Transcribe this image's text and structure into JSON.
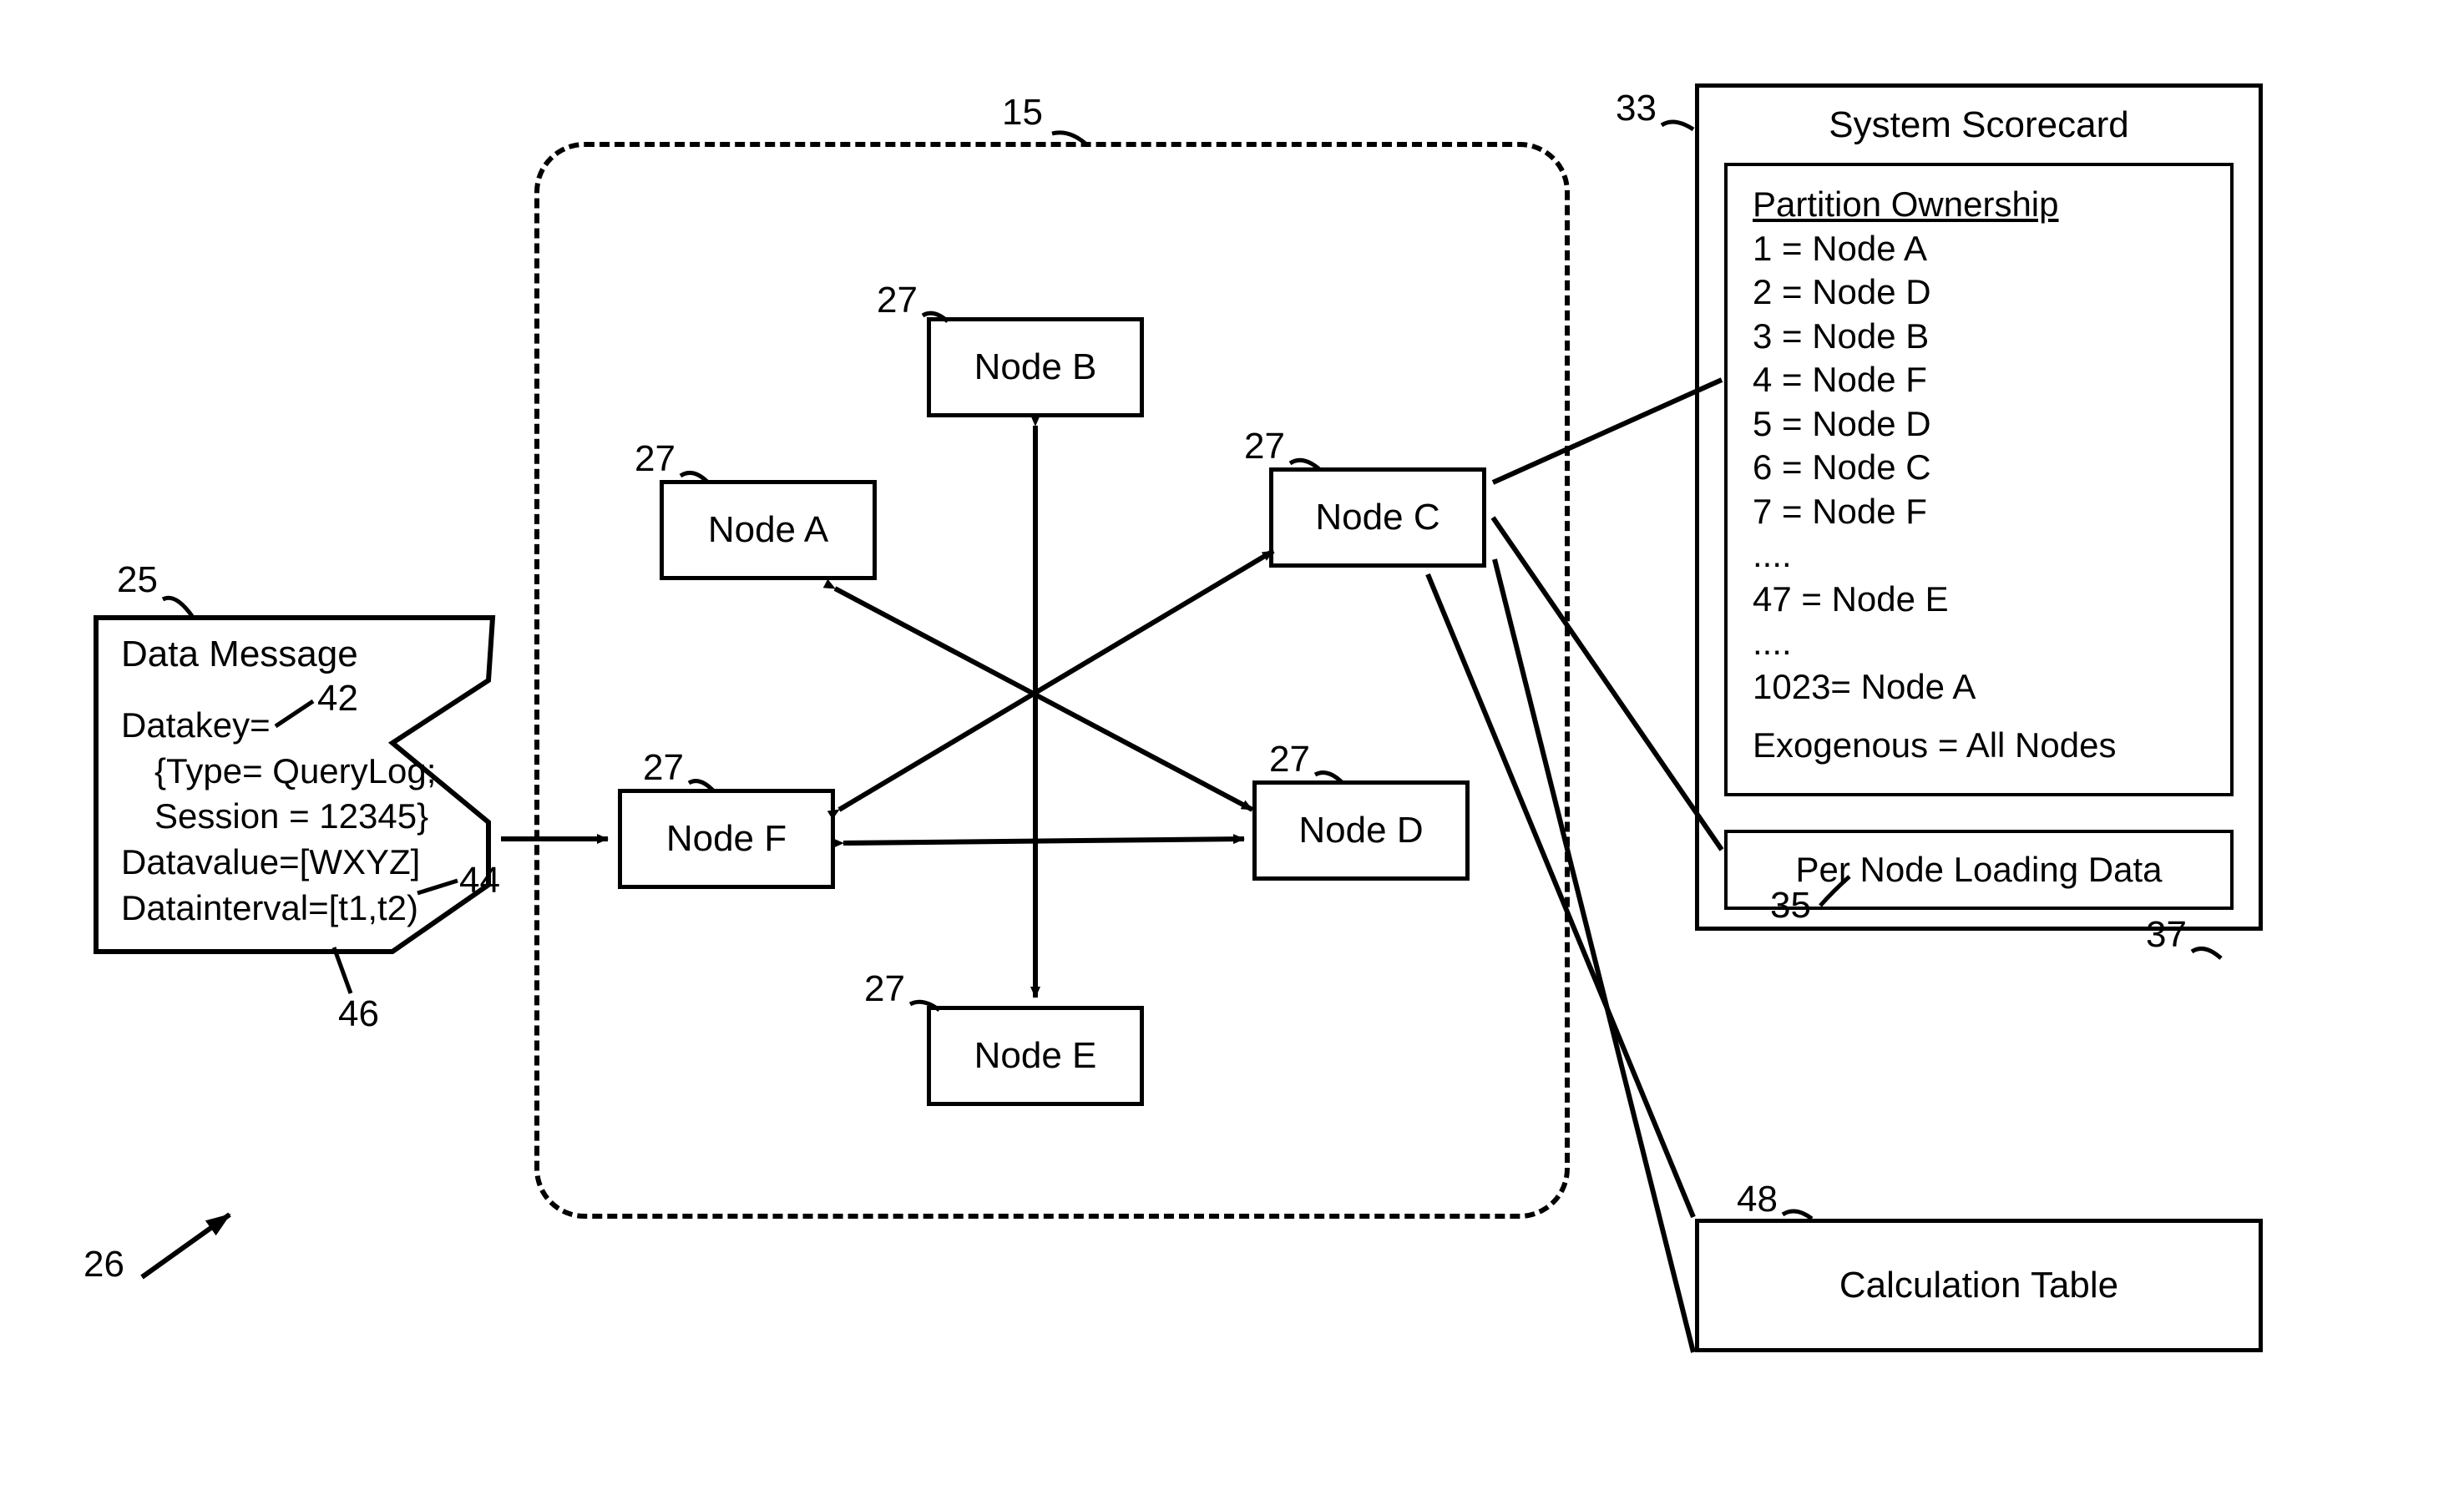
{
  "refs": {
    "r15": "15",
    "r25": "25",
    "r26": "26",
    "r27": "27",
    "r33": "33",
    "r35": "35",
    "r37": "37",
    "r42": "42",
    "r44": "44",
    "r46": "46",
    "r48": "48"
  },
  "nodes": {
    "A": "Node A",
    "B": "Node B",
    "C": "Node C",
    "D": "Node D",
    "E": "Node E",
    "F": "Node F"
  },
  "data_message": {
    "title": "Data Message",
    "datakey_line": "Datakey=",
    "type_line": "{Type= QueryLog;",
    "session_line": "Session = 12345}",
    "datavalue_line": "Datavalue=[WXYZ]",
    "datainterval_line": "Datainterval=[t1,t2)"
  },
  "scorecard": {
    "title": "System Scorecard",
    "partition_heading": "Partition Ownership",
    "rows": [
      "1  = Node A",
      "2  = Node D",
      "3  = Node B",
      "4  = Node F",
      "5  = Node D",
      "6  = Node C",
      "7  = Node F",
      "....",
      "47 = Node E",
      "....",
      "1023= Node A"
    ],
    "exogenous": "Exogenous = All Nodes",
    "per_node": "Per Node Loading Data"
  },
  "calc_table": "Calculation Table"
}
